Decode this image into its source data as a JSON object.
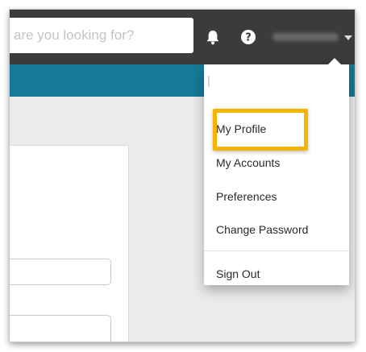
{
  "header": {
    "search": {
      "value": "",
      "placeholder": "are you looking for?"
    },
    "icons": {
      "notifications": "bell-icon",
      "help": "help-icon",
      "user_menu_toggle": "chevron-down-icon"
    }
  },
  "dropdown": {
    "items": [
      {
        "label": "My Profile"
      },
      {
        "label": "My Accounts"
      },
      {
        "label": "Preferences"
      },
      {
        "label": "Change Password"
      },
      {
        "label": "Sign Out"
      }
    ]
  },
  "colors": {
    "topbar": "#3b3b3b",
    "nav_strip": "#157a98",
    "highlight": "#f4b400",
    "background": "#ebebeb"
  }
}
